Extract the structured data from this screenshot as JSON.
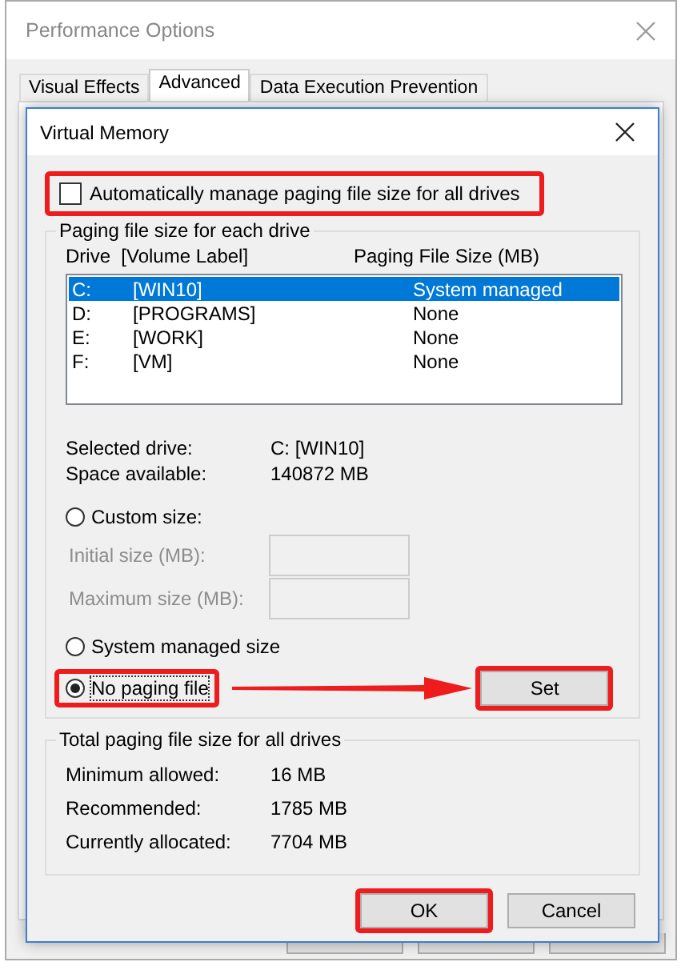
{
  "window": {
    "title": "Performance Options"
  },
  "tabs": [
    {
      "label": "Visual Effects",
      "selected": false
    },
    {
      "label": "Advanced",
      "selected": true
    },
    {
      "label": "Data Execution Prevention",
      "selected": false
    }
  ],
  "dialog": {
    "title": "Virtual Memory",
    "auto_manage": {
      "label": "Automatically manage paging file size for all drives",
      "checked": false,
      "highlighted": true
    },
    "drives_group": {
      "title": "Paging file size for each drive",
      "columns": [
        "Drive  [Volume Label]",
        "Paging File Size (MB)"
      ],
      "rows": [
        {
          "drive": "C:",
          "label": "[WIN10]",
          "size": "System managed",
          "selected": true
        },
        {
          "drive": "D:",
          "label": "[PROGRAMS]",
          "size": "None",
          "selected": false
        },
        {
          "drive": "E:",
          "label": "[WORK]",
          "size": "None",
          "selected": false
        },
        {
          "drive": "F:",
          "label": "[VM]",
          "size": "None",
          "selected": false
        }
      ],
      "info": [
        {
          "label": "Selected drive:",
          "value": "C:  [WIN10]"
        },
        {
          "label": "Space available:",
          "value": "140872 MB"
        }
      ],
      "custom": {
        "label": "Custom size:",
        "selected": false
      },
      "fields": [
        {
          "label": "Initial size (MB):",
          "disabled": true
        },
        {
          "label": "Maximum size (MB):",
          "disabled": true
        }
      ],
      "options": [
        {
          "label": "System managed size",
          "selected": false,
          "highlighted": false
        },
        {
          "label": "No paging file",
          "selected": true,
          "highlighted": true
        }
      ],
      "set_button": {
        "label": "Set",
        "highlighted": true
      },
      "arrow": true
    },
    "totals_group": {
      "title": "Total paging file size for all drives",
      "rows": [
        {
          "label": "Minimum allowed:",
          "value": "16 MB"
        },
        {
          "label": "Recommended:",
          "value": "1785 MB"
        },
        {
          "label": "Currently allocated:",
          "value": "7704 MB"
        }
      ]
    },
    "buttons": [
      {
        "label": "OK",
        "highlighted": true
      },
      {
        "label": "Cancel",
        "highlighted": false
      }
    ]
  }
}
